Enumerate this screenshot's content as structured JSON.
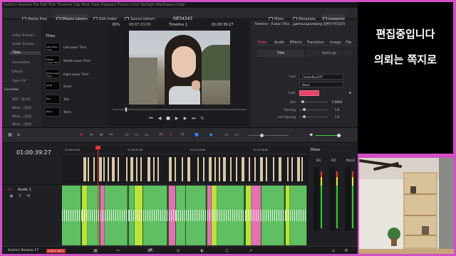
{
  "app": {
    "name": "DaVinci Resolve 17",
    "badge": "PUBLIC BETA",
    "project": "fdf34343"
  },
  "menu": [
    "DaVinci Resolve",
    "File",
    "Edit",
    "Trim",
    "Timeline",
    "Clip",
    "Mark",
    "View",
    "Playback",
    "Fusion",
    "Color",
    "Fairlight",
    "Workspace",
    "Help"
  ],
  "toolbar": {
    "media_pool": "Media Pool",
    "effects_library": "Effects Library",
    "edit_index": "Edit Index",
    "sound_library": "Sound Library",
    "mixer": "Mixer",
    "metadata": "Metadata",
    "inspector": "Inspector"
  },
  "viewer": {
    "zoom": "29%",
    "src_timecode": "00:07:23:00",
    "timeline_name": "Timeline 1",
    "timecode": "01:00:39:27"
  },
  "effects": {
    "side_items": [
      "Video Transiti...",
      "Audio Transiti...",
      "Titles",
      "Generators",
      "Effects",
      "Open FX"
    ],
    "favorites_label": "Favorites",
    "favorites": [
      "BDT...끌시작",
      "Work...(흔들)",
      "Work...(흔들)",
      "Work...(흔들)"
    ],
    "header": "Titles",
    "titles": [
      "Left Lower Third",
      "Middle Lower Third",
      "Right Lower Third",
      "Scroll",
      "Text",
      "Text+"
    ]
  },
  "inspector": {
    "title": "Timeline - Fusion Title ...gamsungcamping 상본이 어디갔지",
    "tabs": [
      "Video",
      "Audio",
      "Effects",
      "Transition",
      "Image",
      "File"
    ],
    "subtabs": [
      "Title",
      "Settings"
    ],
    "font_label": "Font",
    "font_value": "CookieRunOTF",
    "style_value": "Black",
    "color_label": "Color",
    "color_value": "#e8436b",
    "size_label": "Size",
    "size_value": "0.0808",
    "tracking_label": "Tracking",
    "tracking_value": "1.0",
    "line_spacing_label": "Line Spacing",
    "line_spacing_value": "1.0"
  },
  "timeline": {
    "timecode": "01:00:39:27",
    "ruler": [
      "01:00:00:00",
      "01:00:32:00",
      "01:01:04:00",
      "01:01:36:00"
    ],
    "audio_track": "Audio 1",
    "audio_track_id": "A1"
  },
  "mixer": {
    "title": "Mixer",
    "channels": [
      "A1",
      "A2",
      "Bus1"
    ]
  },
  "overlay": {
    "line1": "편집중입니다",
    "line2": "의뢰는 쪽지로"
  },
  "colors": {
    "accent": "#e8436b",
    "frame": "#d24fc6",
    "audio_clip": "#5fbf62",
    "audio_highlight": "#b8e23c",
    "audio_pink": "#e56fb2"
  }
}
